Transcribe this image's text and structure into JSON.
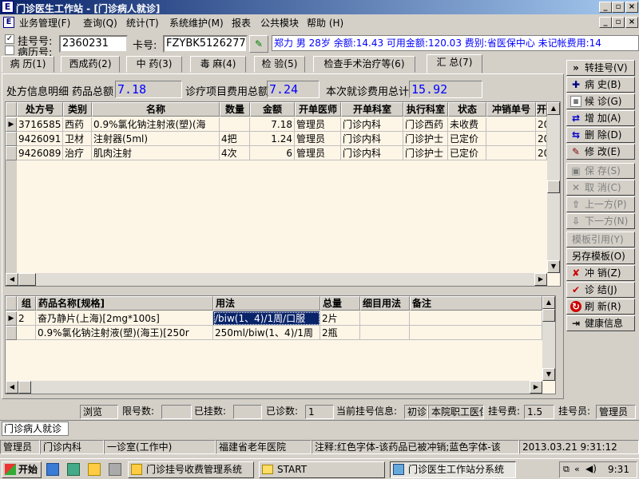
{
  "window": {
    "title": "门诊医生工作站 - [门诊病人就诊]",
    "icon": "medical-app-icon"
  },
  "menu": [
    "业务管理(F)",
    "查询(Q)",
    "统计(T)",
    "系统维护(M)",
    "报表",
    "公共模块",
    "帮助 (H)"
  ],
  "search": {
    "reg_label": "挂号号:",
    "rec_label": "病历号:",
    "reg_value": "2360231",
    "card_label": "卡号:",
    "card_value": "FZYBK51262778",
    "reg_checked": true,
    "rec_checked": false
  },
  "patient_strip": "郑力 男 28岁 余额:14.43 可用金额:120.03 费别:省医保中心 未记帐费用:14",
  "tabs": [
    "病 历(1)",
    "西成药(2)",
    "中 药(3)",
    "毒 麻(4)",
    "检 验(5)",
    "检查手术治疗等(6)",
    "汇 总(7)"
  ],
  "summary": {
    "prescription_label": "处方信息明细",
    "drug_total_label": "药品总额",
    "drug_total": "7.18",
    "item_total_label": "诊疗项目费用总额",
    "item_total": "7.24",
    "visit_total_label": "本次就诊费用总计",
    "visit_total": "15.92"
  },
  "top_grid": {
    "headers": [
      "处方号",
      "类别",
      "名称",
      "数量",
      "金额",
      "开单医师",
      "开单科室",
      "执行科室",
      "状态",
      "冲销单号",
      "开"
    ],
    "rows": [
      [
        "3716585",
        "西药",
        "0.9%氯化钠注射液(塑)(海",
        "",
        "7.18",
        "管理员",
        "门诊内科",
        "门诊西药",
        "未收费",
        "",
        "20"
      ],
      [
        "9426091",
        "卫材",
        "注射器(5ml)",
        "4把",
        "1.24",
        "管理员",
        "门诊内科",
        "门诊护士",
        "已定价",
        "",
        "20"
      ],
      [
        "9426089",
        "治疗",
        "肌肉注射",
        "4次",
        "6",
        "管理员",
        "门诊内科",
        "门诊护士",
        "已定价",
        "",
        "20"
      ]
    ]
  },
  "bottom_grid": {
    "headers": [
      "组",
      "药品名称[规格]",
      "用法",
      "总量",
      "细目用法",
      "备注"
    ],
    "rows": [
      [
        "2",
        "奋乃静片(上海)[2mg*100s]",
        "/biw(1、4)/1周/口服",
        "2片",
        "",
        ""
      ],
      [
        "",
        "0.9%氯化钠注射液(塑)(海王)[250r",
        "250ml/biw(1、4)/1周",
        "2瓶",
        "",
        ""
      ]
    ]
  },
  "side_buttons": [
    {
      "label": "转挂号(V)",
      "icon": "double-arrow-icon",
      "enabled": true
    },
    {
      "label": "病 史(B)",
      "icon": "plus-icon",
      "enabled": true
    },
    {
      "label": "候 诊(G)",
      "icon": "document-icon",
      "enabled": true
    },
    {
      "label": "增 加(A)",
      "icon": "add-icon",
      "enabled": true
    },
    {
      "label": "删 除(D)",
      "icon": "delete-icon",
      "enabled": true
    },
    {
      "label": "修 改(E)",
      "icon": "edit-icon",
      "enabled": true
    },
    {
      "label": "保 存(S)",
      "icon": "save-icon",
      "enabled": false
    },
    {
      "label": "取 消(C)",
      "icon": "cancel-icon",
      "enabled": false
    },
    {
      "label": "上一方(P)",
      "icon": "up-arrow-icon",
      "enabled": false
    },
    {
      "label": "下一方(N)",
      "icon": "down-arrow-icon",
      "enabled": false
    },
    {
      "label": "模板引用(Y)",
      "icon": "",
      "enabled": false
    },
    {
      "label": "另存模板(O)",
      "icon": "",
      "enabled": true
    },
    {
      "label": "冲 销(Z)",
      "icon": "x-red-icon",
      "enabled": true
    },
    {
      "label": "诊 结(J)",
      "icon": "check-red-icon",
      "enabled": true
    },
    {
      "label": "刷 新(R)",
      "icon": "refresh-icon",
      "enabled": true
    },
    {
      "label": "健康信息",
      "icon": "health-info-icon",
      "enabled": true
    }
  ],
  "status_row1": {
    "browse": "浏览",
    "limit_label": "限号数:",
    "limit_value": "",
    "reg_label": "已挂数:",
    "reg_value": "",
    "visited_label": "已诊数:",
    "visited_value": "1",
    "info_label": "当前挂号信息:",
    "info_type": "初诊",
    "info_cat": "本院职工医保",
    "fee_label": "挂号费:",
    "fee_value": "1.5",
    "staff_label": "挂号员:",
    "staff_value": "管理员"
  },
  "window_tab": "门诊病人就诊",
  "status_row2": {
    "user": "管理员",
    "dept": "门诊内科",
    "room": "一诊室(工作中)",
    "hospital": "福建省老年医院",
    "note": "注释:红色字体-该药品已被冲销;蓝色字体-该",
    "datetime": "2013.03.21  9:31:12"
  },
  "taskbar": {
    "start": "开始",
    "tasks": [
      "门诊挂号收费管理系统",
      "START",
      "门诊医生工作站分系统"
    ],
    "clock": "9:31"
  }
}
